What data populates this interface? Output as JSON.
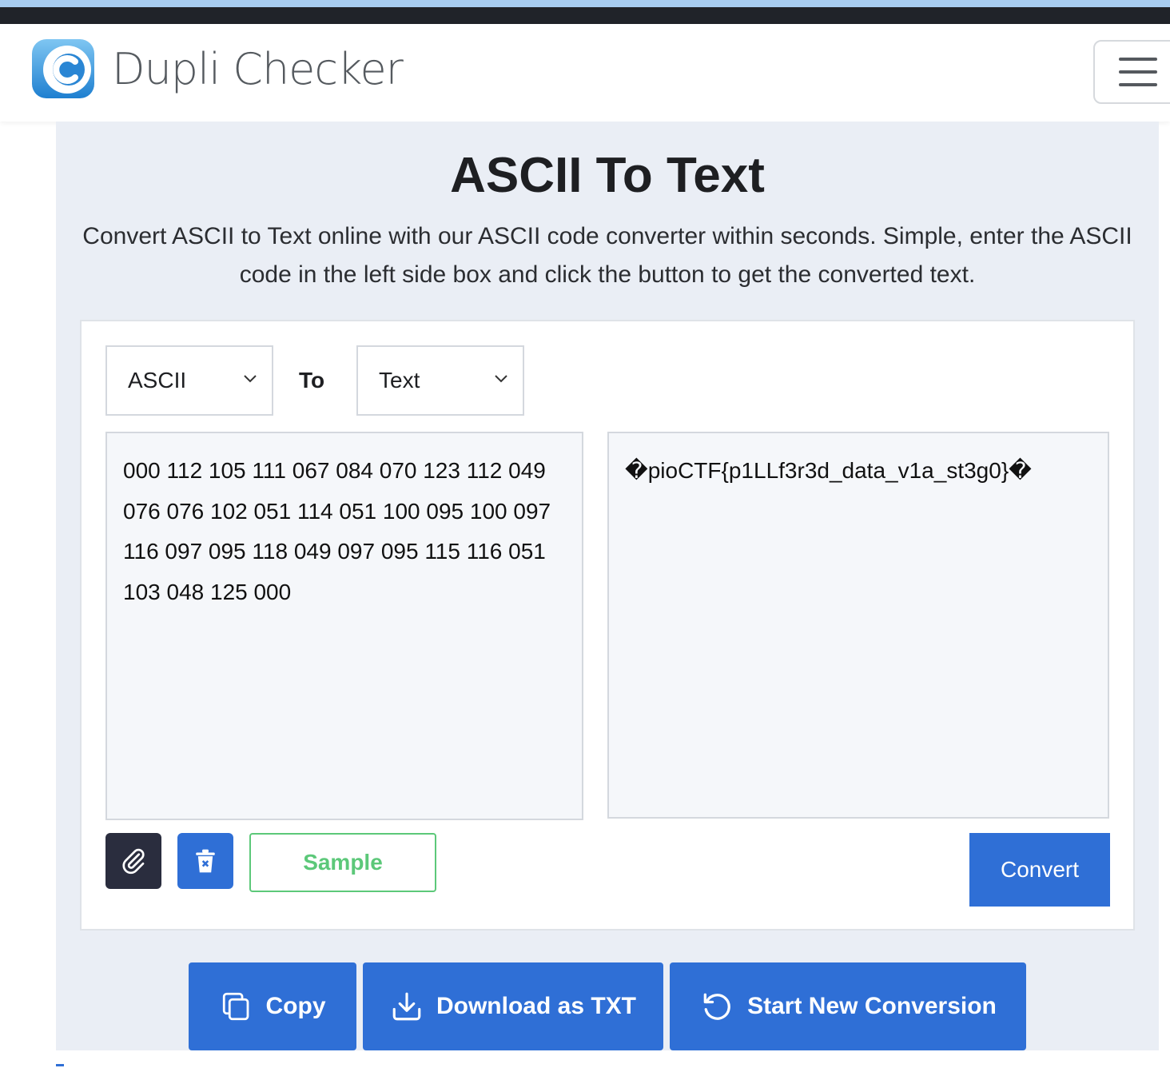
{
  "header": {
    "logo_text": "Dupli Checker",
    "menu_icon": "hamburger-icon"
  },
  "page": {
    "title": "ASCII To Text",
    "description": "Convert ASCII to Text online with our ASCII code converter within seconds. Simple, enter the ASCII code in the left side box and click the button to get the converted text."
  },
  "converter": {
    "from_value": "ASCII",
    "to_label": "To",
    "to_value": "Text",
    "input_text": "000 112 105 111 067 084 070 123 112 049\n076 076 102 051 114 051 100 095 100 097\n116 097 095 118 049 097 095 115 116 051\n103 048 125 000",
    "output_text": "�pioCTF{p1LLf3r3d_data_v1a_st3g0}�",
    "sample_label": "Sample",
    "convert_label": "Convert",
    "upload_icon": "paperclip-icon",
    "clear_icon": "trash-icon"
  },
  "actions": {
    "copy_label": "Copy",
    "download_label": "Download as TXT",
    "restart_label": "Start New Conversion"
  },
  "colors": {
    "primary": "#2f6fd6",
    "sample_green": "#5cc879",
    "dark_button": "#2a2d3e",
    "panel_bg": "#eaeef5"
  }
}
